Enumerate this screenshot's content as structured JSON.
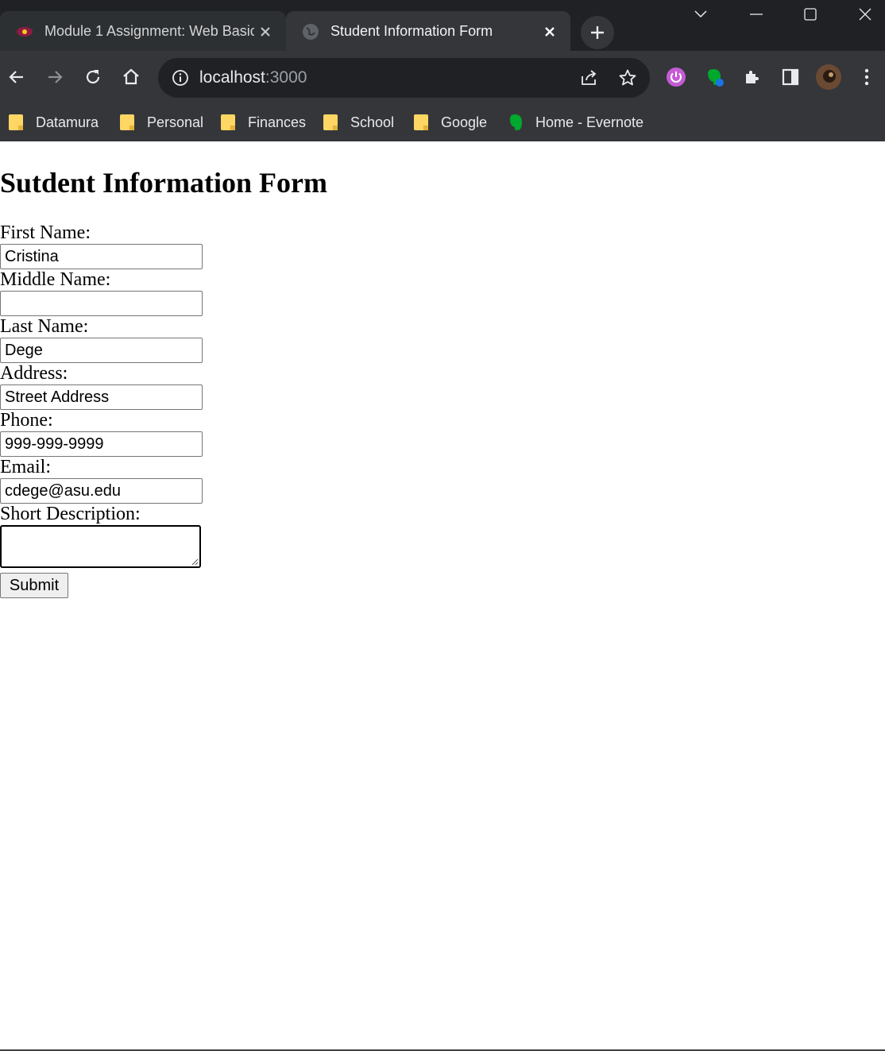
{
  "browser": {
    "tabs": [
      {
        "title": "Module 1 Assignment: Web Basic",
        "active": false
      },
      {
        "title": "Student Information Form",
        "active": true
      }
    ],
    "address": {
      "host": "localhost",
      "port": ":3000"
    },
    "bookmarks": [
      {
        "label": "Datamura",
        "icon": "folder-icon"
      },
      {
        "label": "Personal",
        "icon": "folder-icon"
      },
      {
        "label": "Finances",
        "icon": "folder-icon"
      },
      {
        "label": "School",
        "icon": "folder-icon"
      },
      {
        "label": "Google",
        "icon": "folder-icon"
      },
      {
        "label": "Home - Evernote",
        "icon": "evernote-icon"
      }
    ],
    "colors": {
      "chrome_bg": "#202124",
      "toolbar_bg": "#35363a",
      "folder": "#fdd663",
      "evernote": "#00a82d",
      "extension_power": "#c65bd6"
    }
  },
  "page": {
    "heading": "Sutdent Information Form",
    "form": {
      "first_name": {
        "label": "First Name:",
        "value": "Cristina"
      },
      "middle_name": {
        "label": "Middle Name:",
        "value": ""
      },
      "last_name": {
        "label": "Last Name:",
        "value": "Dege"
      },
      "address": {
        "label": "Address:",
        "value": "Street Address"
      },
      "phone": {
        "label": "Phone:",
        "value": "999-999-9999"
      },
      "email": {
        "label": "Email:",
        "value": "cdege@asu.edu"
      },
      "description": {
        "label": "Short Description:",
        "value": ""
      },
      "submit_label": "Submit"
    }
  }
}
